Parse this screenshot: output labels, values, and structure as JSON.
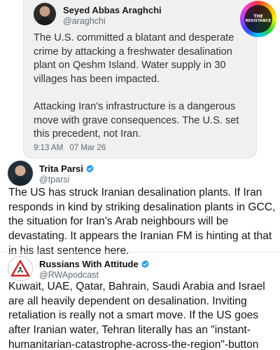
{
  "quoted_tweet": {
    "name": "Seyed Abbas Araghchi",
    "handle": "@araghchi",
    "text": "The U.S. committed a blatant and desperate crime by attacking a freshwater desalination plant on Qeshm Island. Water supply in 30 villages has been impacted.\n\nAttacking Iran's infrastructure is a dangerous move with grave consequences. The U.S. set this precedent, not Iran.",
    "time": "9:13 AM",
    "date": "07 Mar 26",
    "background_color": "#f0f0f0"
  },
  "badge": {
    "line1": "THE",
    "line2": "RESISTANCE"
  },
  "tweets": [
    {
      "name": "Trita Parsi",
      "handle": "@tparsi",
      "verified": true,
      "text": "The US has struck Iranian desalination plants. If Iran responds in kind by striking desalination plants in GCC, the situation for Iran's Arab neighbours will be devastating. It appears the Iranian FM is hinting at that in his last sentence here."
    },
    {
      "name": "Russians With Attitude",
      "handle": "@RWApodcast",
      "verified": true,
      "text": "Kuwait, UAE, Qatar, Bahrain, Saudi Arabia and Israel are all heavily dependent on desalination. Inviting retaliation is really not a smart move. If the US goes after Iranian water, Tehran literally has an \"instant-humanitarian-catastrophe-across-the-region\"-button"
    }
  ],
  "colors": {
    "verified_badge": "#1d9bf0",
    "secondary_text": "#5f6b76"
  }
}
